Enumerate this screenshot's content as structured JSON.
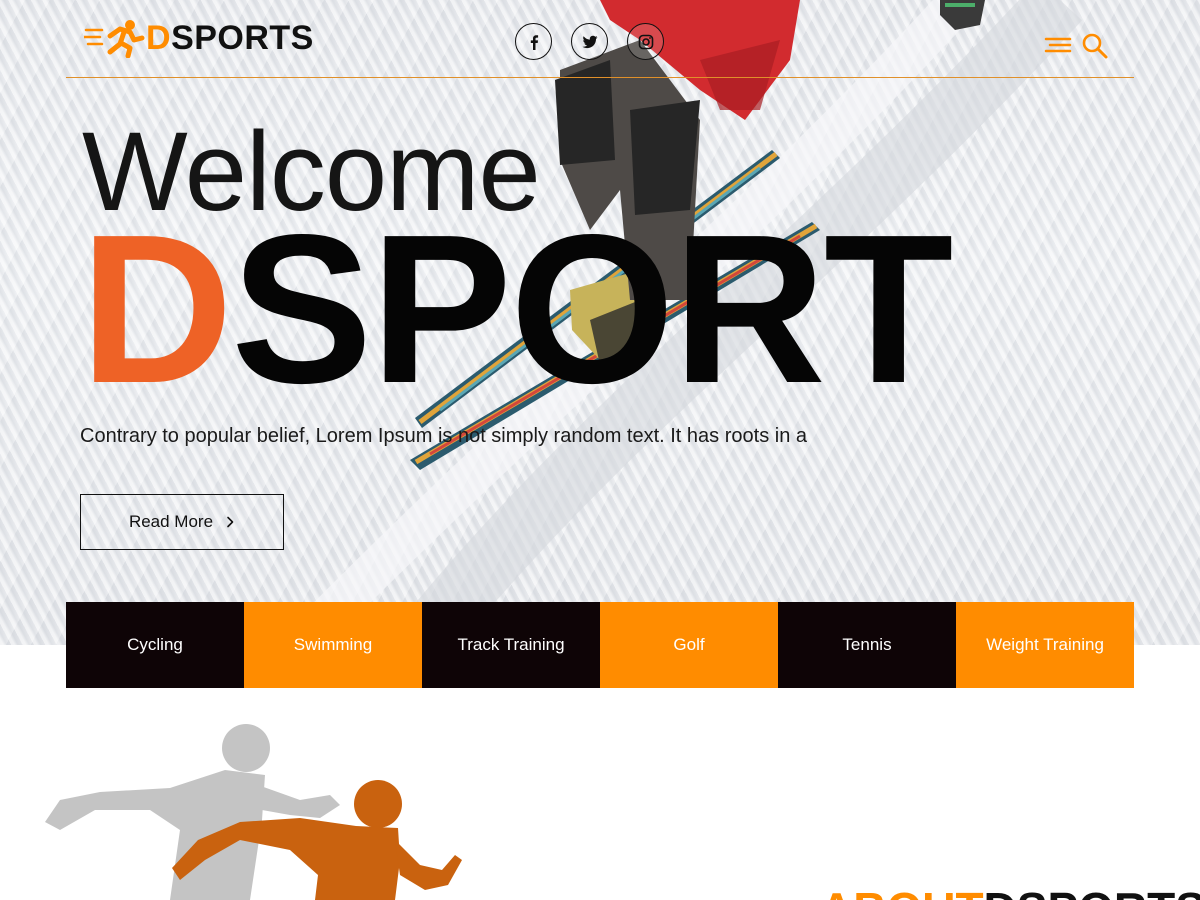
{
  "brand": {
    "logo_letter": "D",
    "logo_rest": "SPORTS",
    "accent_color": "#ff8c00",
    "hero_accent_color": "#ee6226"
  },
  "header": {
    "social_icons": [
      "facebook-icon",
      "twitter-icon",
      "instagram-icon"
    ],
    "menu_icon": "hamburger-menu-icon",
    "search_icon": "search-icon"
  },
  "hero": {
    "welcome": "Welcome",
    "title_letter": "D",
    "title_rest": "SPORT",
    "tagline": "Contrary to popular belief, Lorem Ipsum is not simply random text. It has roots in a",
    "read_more_label": "Read More",
    "read_more_icon": "chevron-right-icon"
  },
  "categories": [
    {
      "label": "Cycling",
      "color": "#0e0406"
    },
    {
      "label": "Swimming",
      "color": "#ff8c00"
    },
    {
      "label": "Track Training",
      "color": "#0e0406"
    },
    {
      "label": "Golf",
      "color": "#ff8c00"
    },
    {
      "label": "Tennis",
      "color": "#0e0406"
    },
    {
      "label": "Weight Training",
      "color": "#ff8c00"
    }
  ],
  "about": {
    "heading_accent": "ABOUT",
    "heading_rest": "DSPORTS"
  }
}
